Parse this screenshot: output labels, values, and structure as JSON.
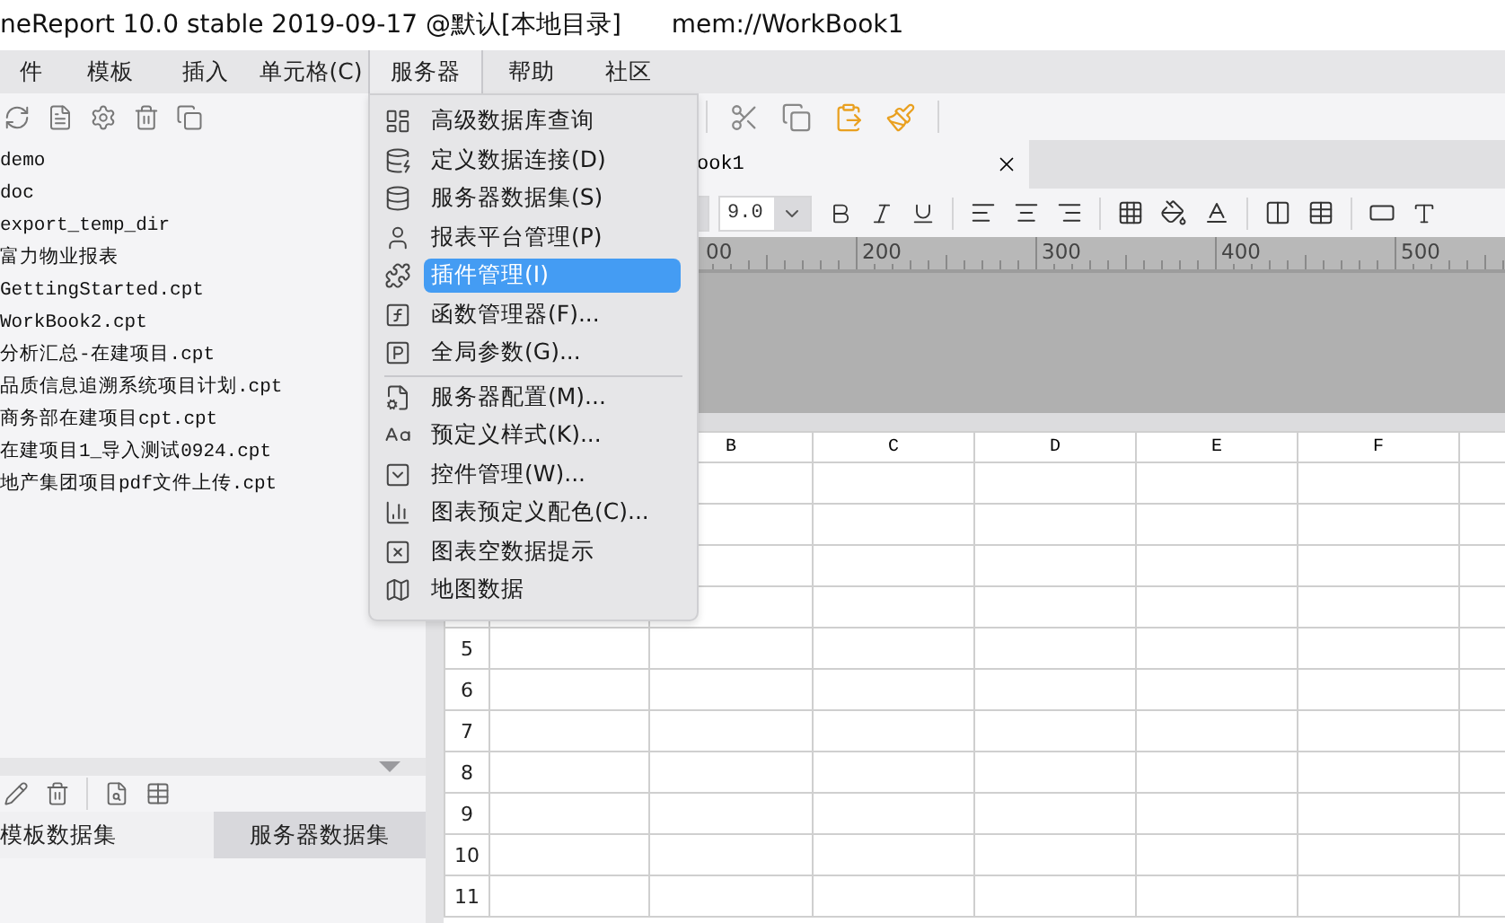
{
  "title_bar": {
    "app": "neReport 10.0 stable 2019-09-17 @默认[本地目录]",
    "file": "mem://WorkBook1"
  },
  "menu_bar": [
    {
      "label": "件",
      "selected": false
    },
    {
      "label": "模板",
      "selected": false
    },
    {
      "label": "插入",
      "selected": false
    },
    {
      "label": "单元格(C)",
      "selected": false
    },
    {
      "label": "服务器",
      "selected": true
    },
    {
      "label": "帮助",
      "selected": false
    },
    {
      "label": "社区",
      "selected": false
    }
  ],
  "file_tree": [
    "demo",
    "doc",
    "export_temp_dir",
    "富力物业报表",
    "GettingStarted.cpt",
    "WorkBook2.cpt",
    "分析汇总-在建项目.cpt",
    "品质信息追溯系统项目计划.cpt",
    "商务部在建项目cpt.cpt",
    "在建项目1_导入测试0924.cpt",
    "地产集团项目pdf文件上传.cpt"
  ],
  "dataset_tabs": [
    {
      "label": "模板数据集",
      "selected": true
    },
    {
      "label": "服务器数据集",
      "selected": false
    }
  ],
  "editor_tab": {
    "label": "ook1"
  },
  "font_size": "9.0",
  "ruler": [
    "00",
    "200",
    "300",
    "400",
    "500"
  ],
  "grid": {
    "columns": [
      "B",
      "C",
      "D",
      "E",
      "F"
    ],
    "rows": [
      "5",
      "6",
      "7",
      "8",
      "9",
      "10",
      "11"
    ]
  },
  "server_menu": {
    "groups": [
      [
        {
          "label": "高级数据库查询",
          "selected": false
        },
        {
          "label": "定义数据连接(D)",
          "selected": false
        },
        {
          "label": "服务器数据集(S)",
          "selected": false
        },
        {
          "label": "报表平台管理(P)",
          "selected": false
        },
        {
          "label": "插件管理(I)",
          "selected": true
        },
        {
          "label": "函数管理器(F)...",
          "selected": false
        },
        {
          "label": "全局参数(G)...",
          "selected": false
        }
      ],
      [
        {
          "label": "服务器配置(M)...",
          "selected": false
        },
        {
          "label": "预定义样式(K)...",
          "selected": false
        },
        {
          "label": "控件管理(W)...",
          "selected": false
        },
        {
          "label": "图表预定义配色(C)...",
          "selected": false
        },
        {
          "label": "图表空数据提示",
          "selected": false
        },
        {
          "label": "地图数据",
          "selected": false
        }
      ]
    ]
  }
}
